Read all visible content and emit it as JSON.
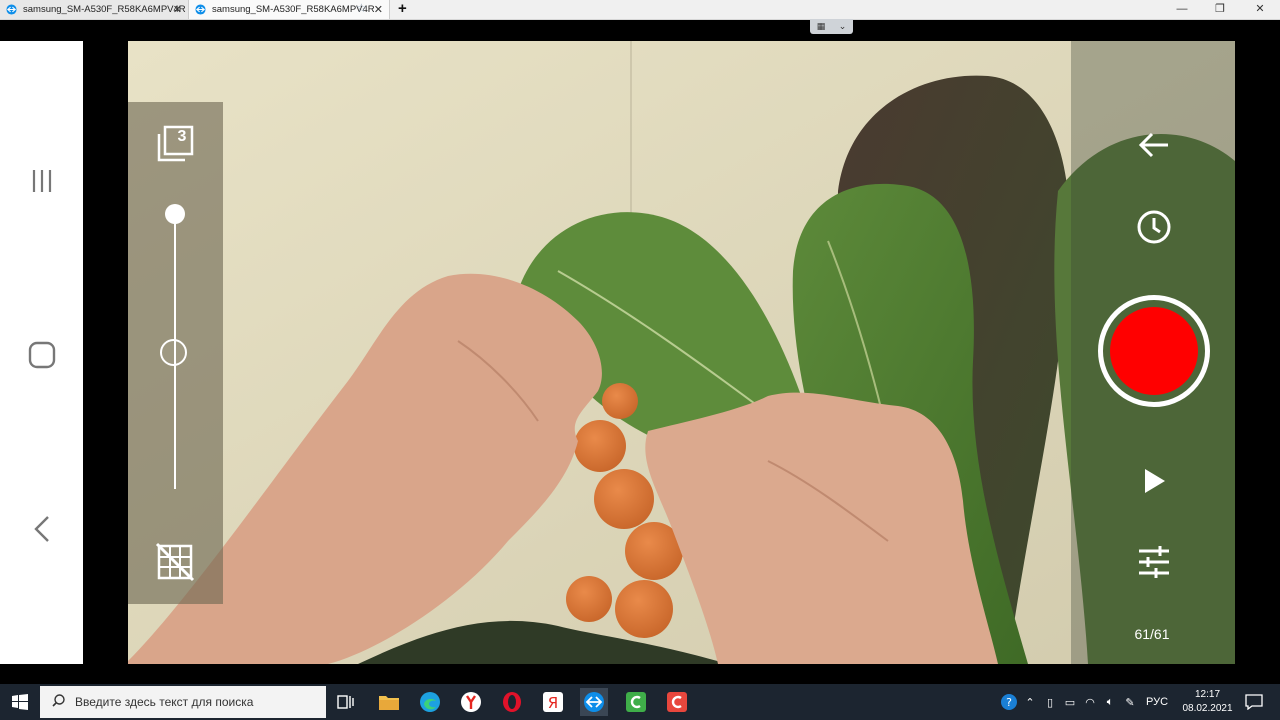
{
  "browser": {
    "tabs": [
      {
        "label": "samsung_SM-A530F_R58KA6MPV4R",
        "active": false
      },
      {
        "label": "samsung_SM-A530F_R58KA6MPV4R",
        "active": true
      }
    ],
    "new_tab_label": "+",
    "window_controls": [
      "minimize-icon",
      "restore-icon",
      "close-icon"
    ]
  },
  "remote_toolbar": {
    "handle_icons": [
      "grid-icon",
      "chevron-down-icon"
    ]
  },
  "android_nav": {
    "buttons": [
      "recents-icon",
      "home-icon",
      "back-icon"
    ]
  },
  "camera": {
    "left_panel": {
      "frames_badge": "3",
      "slider_top_level": 0.0,
      "slider_mid_level": 0.5,
      "grid_off_icon": "grid-off-icon"
    },
    "right_panel": {
      "back_icon": "arrow-left-icon",
      "timer_icon": "clock-icon",
      "record_color": "#ff0000",
      "play_icon": "play-icon",
      "settings_icon": "sliders-icon",
      "frame_counter": "61/61"
    }
  },
  "taskbar": {
    "search_placeholder": "Введите здесь текст для поиска",
    "apps": [
      "task-view-icon",
      "file-explorer-icon",
      "edge-icon",
      "yandex-browser-icon",
      "opera-icon",
      "yandex-icon",
      "teamviewer-icon",
      "camtasia-green-icon",
      "camtasia-red-icon"
    ],
    "language": "РУС",
    "time": "12:17",
    "date": "08.02.2021"
  }
}
